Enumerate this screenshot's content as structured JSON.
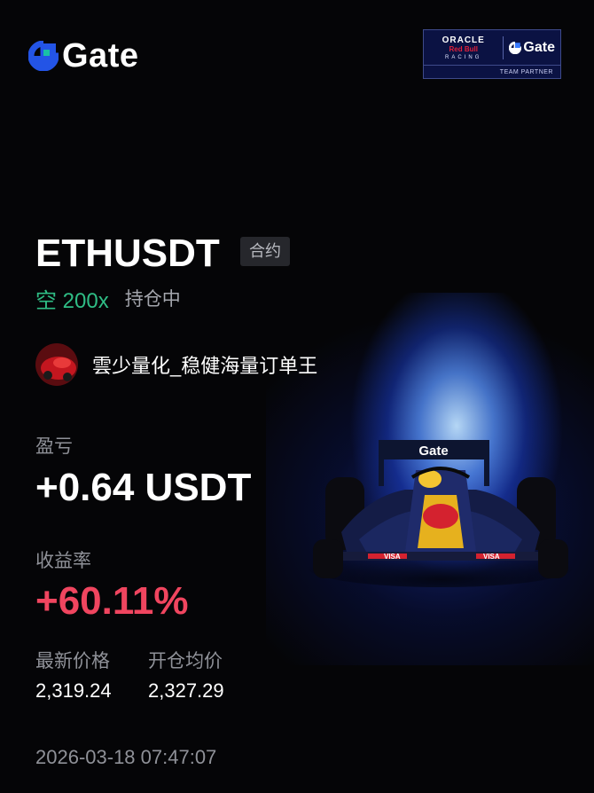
{
  "brand": {
    "name": "Gate",
    "color": "#2354e6",
    "icon": "gate-logo-icon"
  },
  "partner_badge": {
    "line1": "ORACLE",
    "line2": "Red Bull",
    "line3": "RACING",
    "gate": "Gate",
    "caption": "TEAM PARTNER"
  },
  "position": {
    "pair": "ETHUSDT",
    "type_tag": "合约",
    "direction": "空 200x",
    "status": "持仓中"
  },
  "user": {
    "name": "雲少量化_稳健海量订单王",
    "avatar_icon": "avatar-red-car"
  },
  "pnl": {
    "label": "盈亏",
    "value": "+0.64 USDT"
  },
  "roi": {
    "label": "收益率",
    "value": "+60.11%"
  },
  "prices": {
    "latest_label": "最新价格",
    "latest_value": "2,319.24",
    "open_label": "开仓均价",
    "open_value": "2,327.29"
  },
  "timestamp": "2026-03-18 07:47:07",
  "colors": {
    "short": "#2fbd85",
    "profit": "#f0455f",
    "background": "#050507"
  }
}
